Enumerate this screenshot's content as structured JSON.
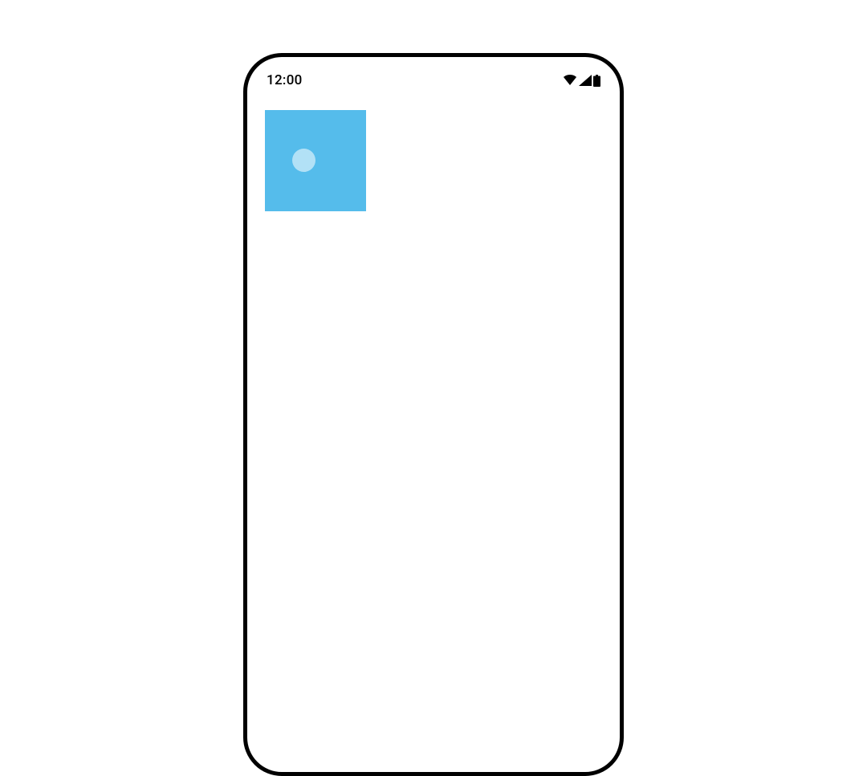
{
  "status_bar": {
    "time": "12:00"
  },
  "colors": {
    "square": "#55bceb",
    "frame_border": "#000000",
    "ripple": "rgba(255,255,255,0.55)"
  }
}
